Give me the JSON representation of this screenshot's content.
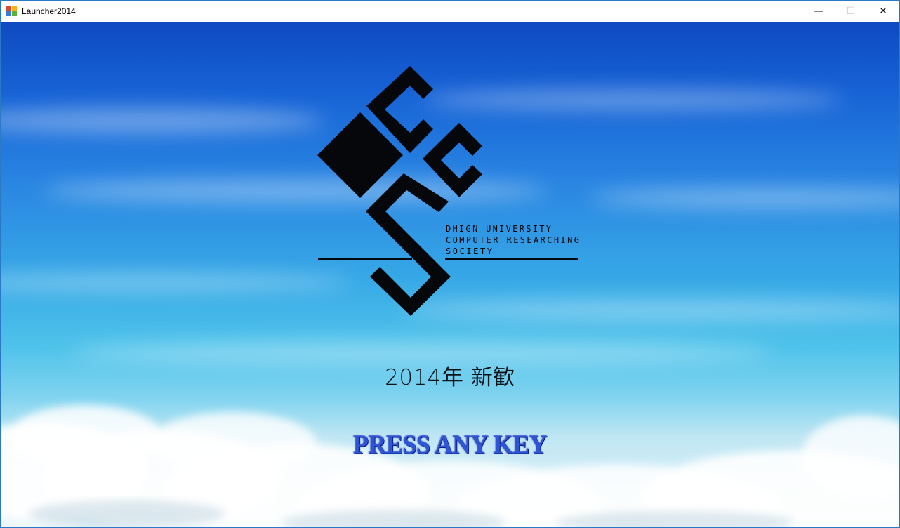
{
  "window": {
    "title": "Launcher2014"
  },
  "controls": {
    "minimize": "—",
    "maximize": "☐",
    "close": "✕"
  },
  "logo": {
    "text_lines": [
      "DHIGN UNIVERSITY",
      "COMPUTER RESEARCHING",
      "SOCIETY"
    ]
  },
  "main": {
    "subtitle": "2014年 新歓",
    "prompt": "PRESS ANY KEY"
  }
}
